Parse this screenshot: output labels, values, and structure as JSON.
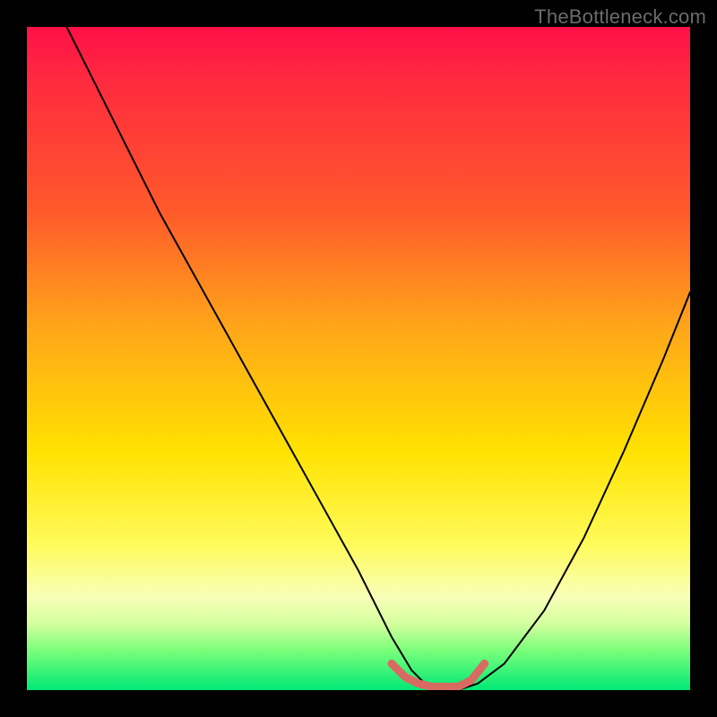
{
  "watermark": "TheBottleneck.com",
  "chart_data": {
    "type": "line",
    "title": "",
    "xlabel": "",
    "ylabel": "",
    "xlim": [
      0,
      100
    ],
    "ylim": [
      0,
      100
    ],
    "annotations": [],
    "series": [
      {
        "name": "bottleneck-curve",
        "stroke": "#000000",
        "width": 2,
        "x": [
          6,
          10,
          15,
          20,
          25,
          30,
          35,
          40,
          45,
          50,
          53,
          55,
          58,
          60,
          63,
          65,
          68,
          72,
          78,
          84,
          90,
          96,
          100
        ],
        "y": [
          100,
          92,
          82,
          72,
          63,
          54,
          45,
          36,
          27,
          18,
          12,
          8,
          3,
          1,
          0,
          0,
          1,
          4,
          12,
          23,
          36,
          50,
          60
        ]
      },
      {
        "name": "flat-minimum-highlight",
        "stroke": "#d96a62",
        "width": 9,
        "x": [
          55,
          57,
          59,
          61,
          63,
          65,
          67,
          69
        ],
        "y": [
          4,
          2,
          1,
          0.5,
          0.5,
          0.5,
          1.5,
          4
        ]
      }
    ],
    "background_gradient_stops": [
      {
        "pos": 0.0,
        "color": "#ff1047"
      },
      {
        "pos": 0.28,
        "color": "#ff5a2a"
      },
      {
        "pos": 0.64,
        "color": "#ffe200"
      },
      {
        "pos": 0.9,
        "color": "#d4ff9e"
      },
      {
        "pos": 1.0,
        "color": "#00e876"
      }
    ]
  }
}
